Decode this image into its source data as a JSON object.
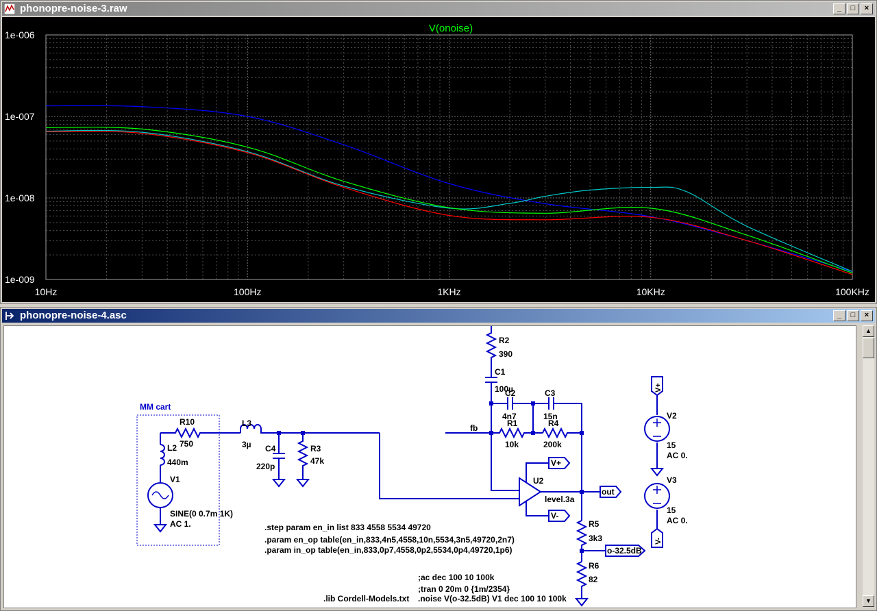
{
  "plot_window": {
    "title": "phonopre-noise-3.raw",
    "buttons": {
      "minimize": "_",
      "maximize": "□",
      "close": "×"
    }
  },
  "schematic_window": {
    "title": "phonopre-noise-4.asc",
    "buttons": {
      "minimize": "_",
      "maximize": "□",
      "close": "×"
    }
  },
  "chart_data": {
    "type": "line",
    "title": "V(onoise)",
    "x_scale": "log",
    "y_scale": "log",
    "xlim": [
      10,
      100000
    ],
    "ylim": [
      1e-09,
      1e-06
    ],
    "x_ticks": [
      "10Hz",
      "100Hz",
      "1KHz",
      "10KHz",
      "100KHz"
    ],
    "y_ticks": [
      "1e-006",
      "1e-007",
      "1e-008",
      "1e-009"
    ],
    "grid": true,
    "series": [
      {
        "color": "#0000ff",
        "x": [
          10,
          30,
          100,
          300,
          1000,
          3000,
          10000,
          30000,
          100000
        ],
        "y": [
          1.35e-07,
          1.32e-07,
          1e-07,
          4.5e-08,
          1.5e-08,
          8.5e-09,
          5.9e-09,
          3e-09,
          1.25e-09
        ]
      },
      {
        "color": "#00c8c8",
        "x": [
          10,
          30,
          100,
          300,
          1000,
          2000,
          3000,
          5000,
          10000,
          15000,
          30000,
          100000
        ],
        "y": [
          6.6e-08,
          6.4e-08,
          3.7e-08,
          1.4e-08,
          7.5e-09,
          8.6e-09,
          1.05e-08,
          1.25e-08,
          1.35e-08,
          1.2e-08,
          4.5e-09,
          1.25e-09
        ]
      },
      {
        "color": "#00ff00",
        "x": [
          10,
          30,
          100,
          300,
          1000,
          3000,
          10000,
          30000,
          100000
        ],
        "y": [
          7.3e-08,
          7e-08,
          4.2e-08,
          1.6e-08,
          7.6e-09,
          6.5e-09,
          7.5e-09,
          3.5e-09,
          1.2e-09
        ]
      },
      {
        "color": "#ff0000",
        "x": [
          10,
          30,
          100,
          300,
          1000,
          3000,
          10000,
          30000,
          100000
        ],
        "y": [
          6.5e-08,
          6.2e-08,
          3.6e-08,
          1.35e-08,
          6.1e-09,
          5.4e-09,
          5.8e-09,
          3e-09,
          1.15e-09
        ]
      }
    ]
  },
  "schematic": {
    "labels": {
      "mm_cart": "MM cart",
      "r10": "R10",
      "r10_val": "750",
      "l2": "L2",
      "l2_val": "440m",
      "v1": "V1",
      "v1_val1": "SINE(0 0.7m 1K)",
      "v1_val2": "AC 1.",
      "l3": "L3",
      "l3_val": "3µ",
      "c4": "C4",
      "c4_val": "220p",
      "r3": "R3",
      "r3_val": "47k",
      "r2": "R2",
      "r2_val": "390",
      "c1": "C1",
      "c1_val": "100µ",
      "c2": "C2",
      "c2_val": "4n7",
      "c3": "C3",
      "c3_val": "15n",
      "r1": "R1",
      "r1_val": "10k",
      "r4": "R4",
      "r4_val": "200k",
      "fb": "fb",
      "u2": "U2",
      "u2_val": "level.3a",
      "vplus_flag": "V+",
      "vminus_flag": "V-",
      "out_flag": "out",
      "r5": "R5",
      "r5_val": "3k3",
      "r6": "R6",
      "r6_val": "82",
      "atten_flag": "o-32.5dB",
      "v2": "V2",
      "v2_val1": "15",
      "v2_val2": "AC 0.",
      "v3": "V3",
      "v3_val1": "15",
      "v3_val2": "AC 0.",
      "vplus_top": "V+",
      "vminus_bot": "V-"
    },
    "directives": [
      ".step param en_in list 833 4558 5534 49720",
      ".param en_op table(en_in,833,4n5,4558,10n,5534,3n5,49720,2n7)",
      ".param in_op table(en_in,833,0p7,4558,0p2,5534,0p4,49720,1p6)",
      ";ac dec 100 10 100k",
      ";tran 0 20m 0 {1m/2354}",
      ".lib Cordell-Models.txt",
      ".noise V(o-32.5dB) V1 dec 100 10 100k"
    ]
  }
}
